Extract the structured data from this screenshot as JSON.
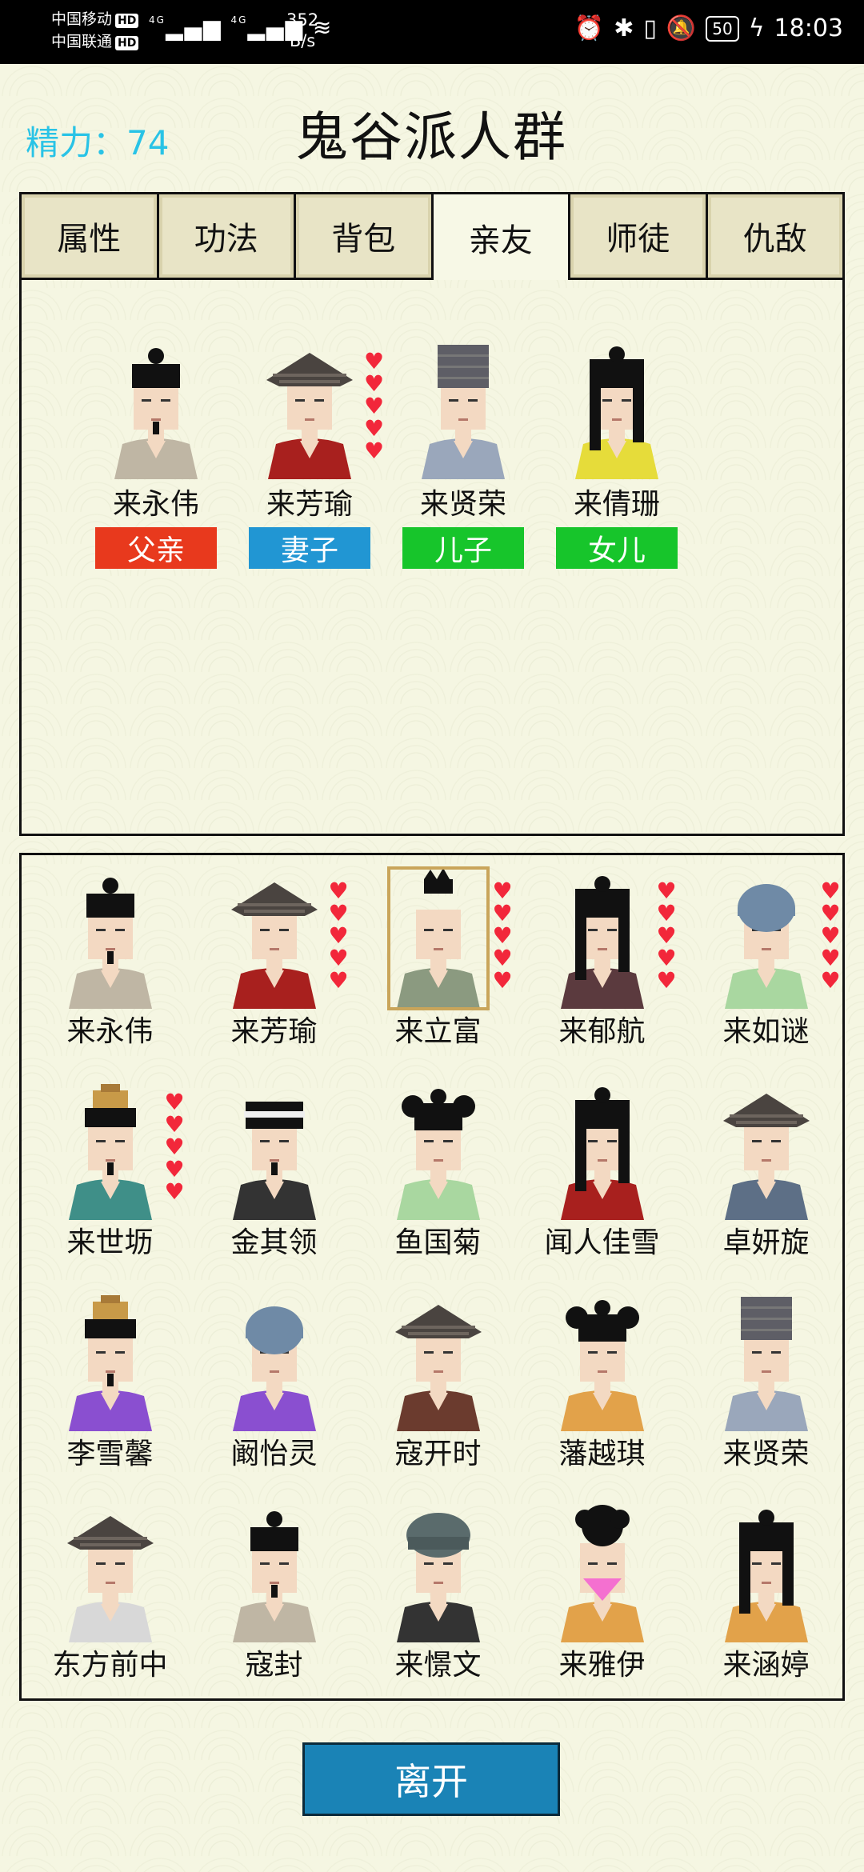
{
  "status_bar": {
    "carrier1": "中国移动",
    "carrier2": "中国联通",
    "hd": "HD",
    "net": "4G",
    "speed_value": "352",
    "speed_unit": "B/s",
    "battery": "50",
    "time": "18:03"
  },
  "header": {
    "energy": "精力：74",
    "title": "鬼谷派人群"
  },
  "tabs": [
    {
      "label": "属性"
    },
    {
      "label": "功法"
    },
    {
      "label": "背包"
    },
    {
      "label": "亲友"
    },
    {
      "label": "师徒"
    },
    {
      "label": "仇敌"
    }
  ],
  "family": [
    {
      "name": "来永伟",
      "relation": "父亲",
      "tag_color": "#e8391d",
      "hearts": 0,
      "hat": "bun",
      "hair": "#111",
      "robe": "#bfb6a4",
      "skin": "#f3d9c2"
    },
    {
      "name": "来芳瑜",
      "relation": "妻子",
      "tag_color": "#2196d3",
      "hearts": 5,
      "hat": "straw",
      "hair": "#111",
      "robe": "#a8201e",
      "skin": "#f3d9c2"
    },
    {
      "name": "来贤荣",
      "relation": "儿子",
      "tag_color": "#17c52b",
      "hearts": 0,
      "hat": "tall",
      "hair": "#111",
      "robe": "#9aa7bb",
      "skin": "#f3d9c2"
    },
    {
      "name": "来倩珊",
      "relation": "女儿",
      "tag_color": "#17c52b",
      "hearts": 0,
      "hat": "long",
      "hair": "#111",
      "robe": "#e6dc3a",
      "skin": "#f3d9c2"
    }
  ],
  "people": [
    {
      "name": "来永伟",
      "hearts": 0,
      "hat": "bun",
      "robe": "#bfb6a4"
    },
    {
      "name": "来芳瑜",
      "hearts": 5,
      "hat": "straw",
      "robe": "#a8201e"
    },
    {
      "name": "来立富",
      "hearts": 5,
      "hat": "spiky",
      "robe": "#8b9a80",
      "selected": true
    },
    {
      "name": "来郁航",
      "hearts": 5,
      "hat": "long",
      "robe": "#5b3a3e"
    },
    {
      "name": "来如谜",
      "hearts": 5,
      "hat": "cap",
      "robe": "#a9d7a0"
    },
    {
      "name": "来世坜",
      "hearts": 5,
      "hat": "crown",
      "robe": "#3f8f88"
    },
    {
      "name": "金其领",
      "hearts": 0,
      "hat": "band",
      "robe": "#333"
    },
    {
      "name": "鱼国菊",
      "hearts": 0,
      "hat": "buns",
      "robe": "#a9d7a0"
    },
    {
      "name": "闻人佳雪",
      "hearts": 0,
      "hat": "long",
      "robe": "#a8201e"
    },
    {
      "name": "卓妍旋",
      "hearts": 0,
      "hat": "straw",
      "robe": "#5d6f86"
    },
    {
      "name": "李雪馨",
      "hearts": 0,
      "hat": "crown",
      "robe": "#8a4fd0"
    },
    {
      "name": "阚怡灵",
      "hearts": 0,
      "hat": "cap",
      "robe": "#8a4fd0"
    },
    {
      "name": "寇开时",
      "hearts": 0,
      "hat": "straw",
      "robe": "#6b3b2e"
    },
    {
      "name": "藩越琪",
      "hearts": 0,
      "hat": "buns",
      "robe": "#e2a24a"
    },
    {
      "name": "来贤荣",
      "hearts": 0,
      "hat": "tall",
      "robe": "#9aa7bb"
    },
    {
      "name": "东方前中",
      "hearts": 0,
      "hat": "straw",
      "robe": "#d8d8d8"
    },
    {
      "name": "寇封",
      "hearts": 0,
      "hat": "bun",
      "robe": "#bfb6a4"
    },
    {
      "name": "来憬文",
      "hearts": 0,
      "hat": "turban",
      "robe": "#333"
    },
    {
      "name": "来雅伊",
      "hearts": 0,
      "hat": "veil",
      "robe": "#e2a24a"
    },
    {
      "name": "来涵婷",
      "hearts": 0,
      "hat": "long",
      "robe": "#e2a24a"
    }
  ],
  "buttons": {
    "leave": "离开"
  }
}
